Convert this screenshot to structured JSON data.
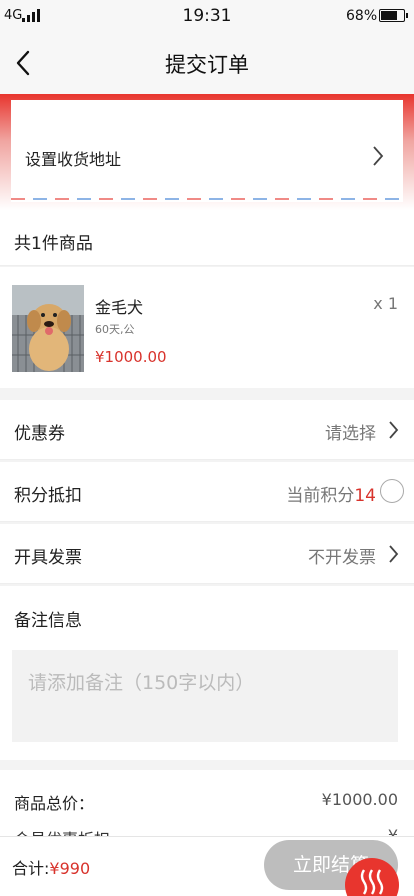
{
  "status": {
    "network": "4G",
    "time": "19:31",
    "battery": "68%",
    "battery_level": 0.68
  },
  "nav": {
    "title": "提交订单"
  },
  "address": {
    "label": "设置收货地址"
  },
  "items_count": "共1件商品",
  "product": {
    "name": "金毛犬",
    "spec": "60天,公",
    "price": "¥1000.00",
    "qty": "x 1"
  },
  "coupon": {
    "label": "优惠券",
    "value": "请选择"
  },
  "points": {
    "label": "积分抵扣",
    "prefix": "当前积分",
    "value": "14"
  },
  "invoice": {
    "label": "开具发票",
    "value": "不开发票"
  },
  "remark": {
    "label": "备注信息",
    "placeholder": "请添加备注（150字以内）"
  },
  "totals": {
    "label": "商品总价：",
    "value": "¥1000.00",
    "label2": "会员优惠折扣",
    "value2": "¥"
  },
  "bottom": {
    "total_label": "合计:",
    "total_value": "¥990",
    "submit": "立即结算"
  },
  "colors": {
    "accent": "#e8352e",
    "price": "#d8332c",
    "button_disabled": "#bdbdbd"
  }
}
